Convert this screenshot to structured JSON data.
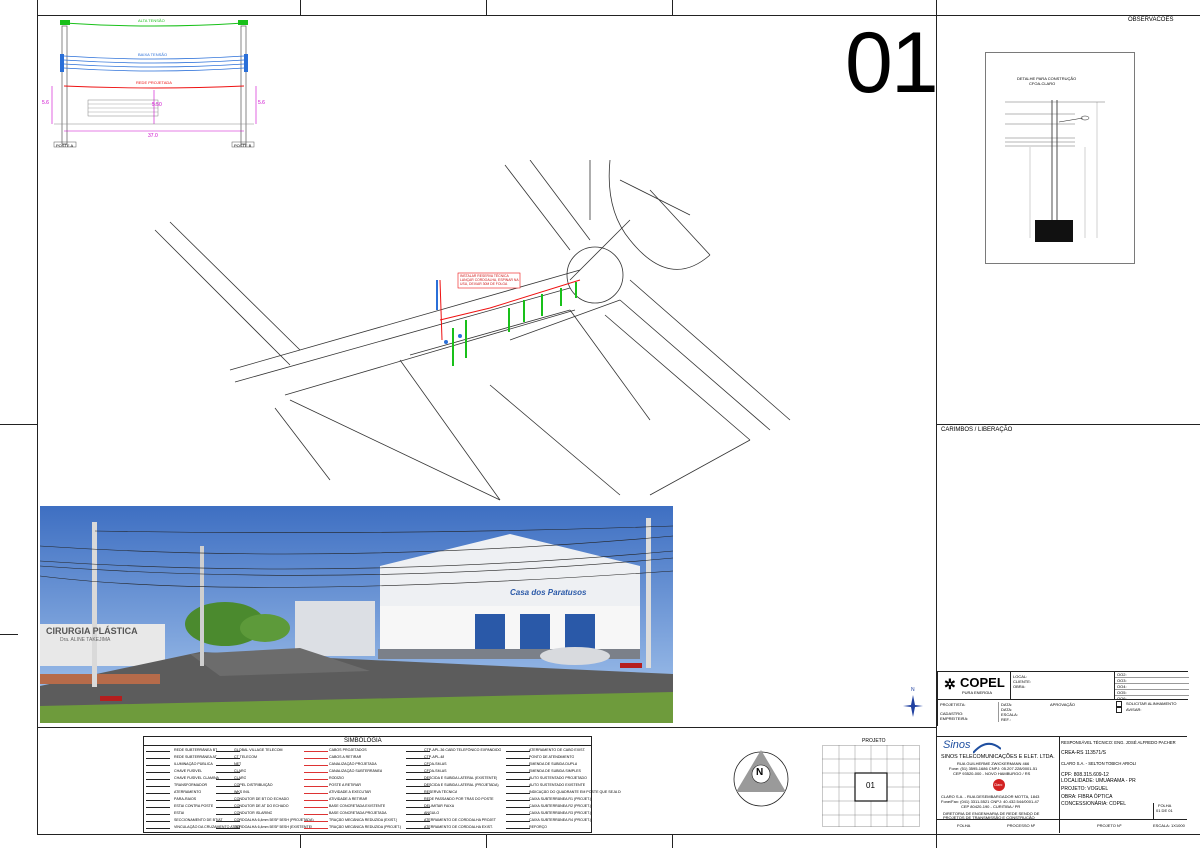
{
  "sheet": {
    "number": "01",
    "observacoes_title": "OBSERVACOES",
    "carimbos_title": "CARIMBOS / LIBERAÇÃO",
    "detail_title_1": "DETALHE PARA CONSTRUÇÃO",
    "detail_title_2": "CFOA-CLARO"
  },
  "crosssection": {
    "alta_tensao": "ALTA TENSÃO",
    "baixa_tensao": "BAIXA TENSÃO",
    "rede_projetada": "REDE PROJETADA",
    "height_left": "5.6",
    "height_center": "5.50",
    "height_right": "5.6",
    "span": "37.0",
    "post_left": "POSTE A",
    "post_right": "POSTE B"
  },
  "map": {
    "callout_1": "INSTALAR RESERVA TÉCNICA",
    "callout_2": "LANÇAR CORDOALHA, ESPINAR NA",
    "callout_3": "USU, DEIXAR 30M DE FOLGA"
  },
  "photo": {
    "sign_title": "CIRURGIA PLÁSTICA",
    "sign_sub": "Dra. ALINE TAKEJIMA",
    "store_name": "Casa dos Paratusos"
  },
  "copel": {
    "logo": "COPEL",
    "sub": "PURA ENERGIA",
    "fields_left": [
      "LOCAL:",
      "CLIENTE:",
      "OBRA:"
    ],
    "fields_right": [
      "OO2:",
      "OO3:",
      "OO4:",
      "OO5:",
      "OO6:"
    ],
    "row_labels": [
      "PROJETISTA:",
      "CADASTRO:",
      "EMPREITEIRA:"
    ],
    "row_labels_2": [
      "DATA:",
      "DATA:",
      "ESCALA:",
      "REF.:"
    ],
    "aprovacao": "APROVAÇÃO",
    "check_1": "SOLICITAR ALINHAMENTO",
    "check_2": "AVISAR:"
  },
  "legend": {
    "title": "SIMBOLOGIA",
    "col1": [
      "REDE SUBTERRÂNEA BT",
      "REDE SUBTERRÂNEA AT",
      "ILUMINAÇÃO PÚBLICA",
      "CHAVE FUSÍVEL",
      "CHAVE FUSÍVEL CLAMINA",
      "TRANSFORMADOR",
      "ATERRAMENTO",
      "PÁRA-RAIOS",
      "ESTAI CONTRA POSTE",
      "ESTAI",
      "SECCIONAMENTO DE BT/AT",
      "VINCULAÇÃO DA CRUZAMENTO AT/BT"
    ],
    "col2": [
      "GLOBAL VILLAGE TELECOM",
      "CT TELECOM",
      "NET",
      "CLARO",
      "CLARO",
      "COPEL DISTRIBUIÇÃO",
      "WKS INIL",
      "CONDUTOR DE BT DO ECHADO",
      "CONDUTOR DE AT DO ECHADO",
      "CONDUTOR ISLARINO",
      "CORDOALHA 6,4mm 5ESF 5ESH (PROJETADA)",
      "CORDOALHA 6,4mm 5ESF 5ESH (EXISTENTE)"
    ],
    "col3": [
      "CABOS PROJETADOS",
      "CABOS A RETIRAR",
      "CANALIZAÇÃO PROJETADA",
      "CANALIZAÇÃO SUBTERRÂNEA",
      "RODÍZIO",
      "POSTE A RETIRAR",
      "ATIVIDADE A EXECUTAR",
      "ATIVIDADE A RETIRAR",
      "BASE CONCRETADA EXISTENTE",
      "BASE CONCRETADA PROJETADA",
      "TRAÇÃO MECÂNICA REDUZIDA (EXIST.)",
      "TRAÇÃO MECÂNICA REDUZIDA (PROJET.)"
    ],
    "col4": [
      "CTP-APL-36 CABO TELEFÔNICO EXPANDIDO",
      "CTP-APL-48",
      "CFOA-SM-AS",
      "CFOA-SM-AS",
      "DESCIDA E SUBIDA LATERAL (EXISTENTE)",
      "DESCIDA E SUBIDA LATERAL (PROJETADA)",
      "RESERVA TÉCNICA",
      "REDE PASSANDO POR TRÁS DO POSTE",
      "DELIMITAR FAIXA",
      "ANGULO",
      "ATERRAMENTO DE CORDOALHA PROJET",
      "ATERRAMENTO DE CORDOALHA EXIST."
    ],
    "col5": [
      "ATERRAMENTO DE CABO EXIST.",
      "PONTO DE ATENDIMENTO",
      "EMENDA DE SUBIDA DUPLA",
      "EMENDA DE SUBIDA SIMPLES",
      "AUTO SUSTENTADO PROJETADO",
      "AUTO SUSTENTADO EXISTENTE",
      "INDICAÇÃO DO QUADRANTE EM POSTE QUE SEJA DE QUARTA ESTAÇÃO",
      "CAIXA SUBTERRÂNEA R1 (PROJET.)",
      "CAIXA SUBTERRÂNEA R2 (PROJET.)",
      "CAIXA SUBTERRÂNEA R3 (PROJET.)",
      "CAIXA SUBTERRÂNEA R4 (PROJET.)",
      "REFORÇO"
    ]
  },
  "compass": {
    "letter": "N"
  },
  "projeto_grid": {
    "title": "PROJETO",
    "cell": "01"
  },
  "sinos": {
    "logo": "Sinos",
    "company": "SINOS TELECOMUNICAÇÕES E ELET. LTDA.",
    "address_1": "RUA GUILHERME ZWICKERMANN 466",
    "address_2": "Fone: (51) 3595-1686  CNPJ: 05.207.228/0001-51",
    "address_3": "CEP 93520-000 - NOVO HAMBURGO / RS",
    "claro_badge": "Claro",
    "claro_1": "CLARO S.A. - RUA DESEMBARGADOR MOTTA, 1843",
    "claro_2": "Fone/Fax: (041) 3311-5521  CNPJ: 40.432.544/0001-47",
    "claro_3": "CEP 80420-190 - CURITIBA / PR",
    "claro_4": "DIRETORIA DE ENGENHARIA DE REDE SENDO DE",
    "claro_5": "PROJETOS DE TRANSMISSÃO E CONSTRUÇÃO",
    "responsavel": "RESPONSÁVEL TÉCNICO: ENG. JOSÉ ALFREDO PACHER",
    "crea": "CREA-RS  113571/S",
    "cliente": "CLARO S.A. - SELTON TOBICH ARIOLI",
    "cpf": "CPF: 808.315.609-12",
    "localidade": "LOCALIDADE: UMUARAMA - PR",
    "projeto": "PROJETO: VOGUEL",
    "obra": "OBRA: FIBRA ÓPTICA",
    "concessionaria": "CONCESSIONÁRIA: COPEL",
    "folha_label": "FOLHA",
    "processo_label": "PROCESSO Nº",
    "projeto_label": "PROJETO Nº",
    "folha_right": "FOLHA",
    "folha_value": "01 DE 01",
    "escala": "ESCALA: 1X1000"
  }
}
